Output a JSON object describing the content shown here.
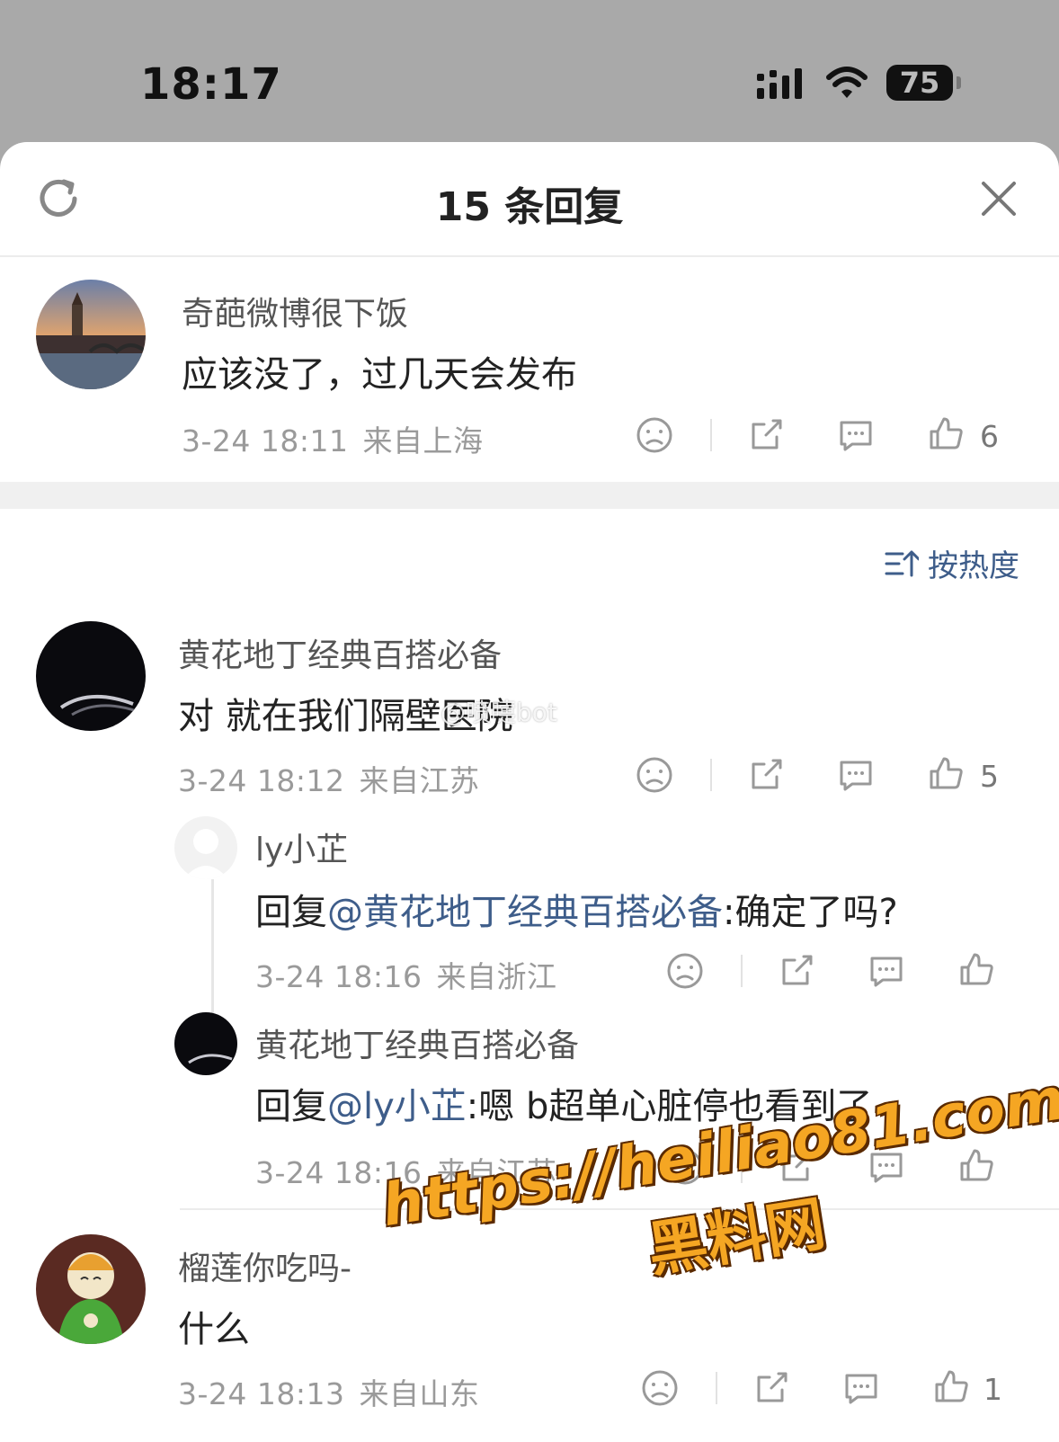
{
  "status_bar": {
    "time": "18:17",
    "battery": "75"
  },
  "header": {
    "title": "15 条回复"
  },
  "root_comment": {
    "username": "奇葩微博很下饭",
    "text": "应该没了，过几天会发布",
    "date": "3-24 18:11",
    "location": "来自上海",
    "likes": "6"
  },
  "sort": {
    "label": "按热度"
  },
  "replies": [
    {
      "username": "黄花地丁经典百搭必备",
      "text": "对 就在我们隔壁医院",
      "date": "3-24 18:12",
      "location": "来自江苏",
      "likes": "5",
      "sub_replies": [
        {
          "username": "ly小芷",
          "prefix": "回复",
          "mention": "@黄花地丁经典百搭必备",
          "text": ":确定了吗?",
          "date": "3-24 18:16",
          "location": "来自浙江"
        },
        {
          "username": "黄花地丁经典百搭必备",
          "prefix": "回复",
          "mention": "@ly小芷",
          "text": ":嗯 b超单心脏停也看到了",
          "date": "3-24 18:16",
          "location": "来自江苏"
        }
      ]
    },
    {
      "username": "榴莲你吃吗-",
      "text": "什么",
      "date": "3-24 18:13",
      "location": "来自山东",
      "likes": "1"
    }
  ],
  "watermark": {
    "small": "@喷嚏bot",
    "url": "https://heiliao81.com",
    "name": "黑料网"
  },
  "colors": {
    "accent": "#3e5d8a",
    "muted": "#9a9a9a",
    "watermark": "#f5a623"
  }
}
